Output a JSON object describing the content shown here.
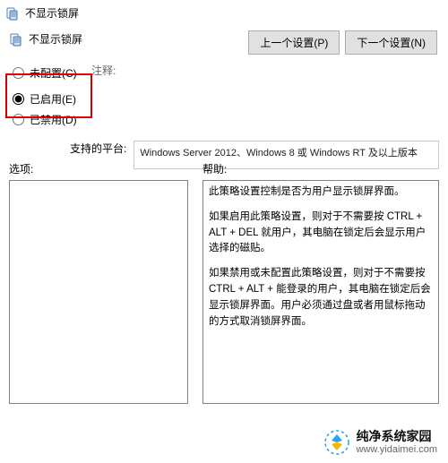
{
  "window": {
    "title": "不显示锁屏",
    "inner_title": "不显示锁屏"
  },
  "nav": {
    "prev_label": "上一个设置(P)",
    "next_label": "下一个设置(N)"
  },
  "config": {
    "comment_label": "注释:",
    "radios": {
      "not_configured": "未配置(C)",
      "enabled": "已启用(E)",
      "disabled": "已禁用(D)"
    },
    "selected": "enabled"
  },
  "platform": {
    "label": "支持的平台:",
    "text": "Windows Server 2012、Windows 8 或 Windows RT 及以上版本"
  },
  "columns": {
    "options_label": "选项:",
    "help_label": "帮助:"
  },
  "help": {
    "p1": "此策略设置控制是否为用户显示锁屏界面。",
    "p2": "如果启用此策略设置，则对于不需要按 CTRL + ALT + DEL 就用户，其电脑在锁定后会显示用户选择的磁贴。",
    "p3": "如果禁用或未配置此策略设置，则对于不需要按 CTRL + ALT + 能登录的用户，其电脑在锁定后会显示锁屏界面。用户必须通过盘或者用鼠标拖动的方式取消锁屏界面。"
  },
  "watermark": {
    "name": "纯净系统家园",
    "url": "www.yidaimei.com"
  }
}
